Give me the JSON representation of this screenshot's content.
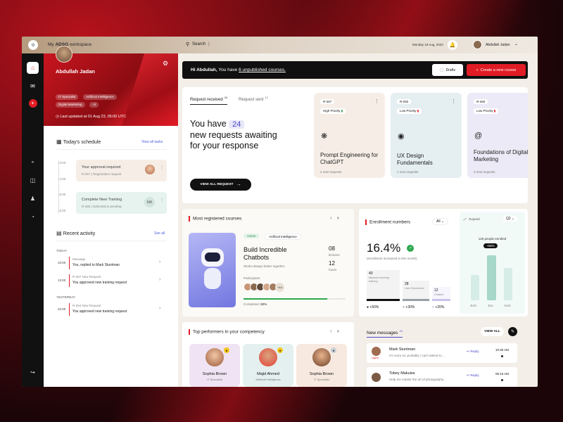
{
  "topbar": {
    "workspace_prefix": "My ",
    "workspace_name": "ADSG",
    "workspace_suffix": " workspace",
    "search_label": "Search",
    "date": "Monday 19 Aug, 2023",
    "user_name": "Abdullah Jadan"
  },
  "profile": {
    "name": "Abdullah Jadan",
    "tags": [
      "IT Specialist",
      "Artificial Intelligence",
      "Digital Marketing",
      "+3"
    ],
    "last_updated": "Last updated at 01 Aug 23, 05:00 UTC"
  },
  "schedule": {
    "title": "Today's schedule",
    "view_all": "View all tasks",
    "times": [
      "13:00",
      "14:00",
      "15:00",
      "16:00"
    ],
    "items": [
      {
        "title": "Your approval required",
        "code": "R-267",
        "sub": "Registration request",
        "avatar": ""
      },
      {
        "title": "Complete New Training",
        "code": "R-265",
        "sub": "Submission pending",
        "avatar": "MA"
      }
    ]
  },
  "activity": {
    "title": "Recent activity",
    "see_all": "See all",
    "groups": [
      {
        "label": "TODAY",
        "items": [
          {
            "time": "10:00",
            "type": "Message",
            "text": "You, replied to Mark Stuntman"
          },
          {
            "time": "13:00",
            "type": "R-267 New Request",
            "text": "You approved new training request"
          }
        ]
      },
      {
        "label": "YESTERDAY",
        "items": [
          {
            "time": "04:00",
            "type": "R-254 New Request",
            "text": "You approved new training request"
          }
        ]
      }
    ]
  },
  "hero": {
    "greeting": "Hi Abdullah,",
    "text_before": " You have ",
    "link": "6 unpublished courses.",
    "drafts": "Drafts",
    "create": "Create a new course"
  },
  "requests": {
    "tab_received": "Request received",
    "tab_received_count": "24",
    "tab_sent": "Request sent",
    "tab_sent_count": "12",
    "headline_1": "You have",
    "count": "24",
    "headline_2": "new requests awaiting",
    "headline_3": "for your response",
    "view_all": "VIEW ALL REQUEST",
    "cards": [
      {
        "code": "R-267",
        "priority": "High Priority",
        "title": "Prompt Engineering for ChatGPT",
        "count": "2 new requests",
        "bg": "#f6eee6"
      },
      {
        "code": "R-282",
        "priority": "Low Priority",
        "title": "UX Design Fundamentals",
        "count": "1 new requests",
        "bg": "#e5eef1"
      },
      {
        "code": "R-260",
        "priority": "Low Priority",
        "title": "Foundations of Digital Marketing",
        "count": "3 new requests",
        "bg": "#eceaf6"
      }
    ]
  },
  "courses": {
    "title": "Most registered courses",
    "badge_active": "Active",
    "badge_category": "Artificial Intelligence",
    "course_title": "Build Incredible Chatbots",
    "course_sub": "Works always better together.",
    "lectures_num": "08",
    "lectures_label": "lectures",
    "hours_num": "12",
    "hours_label": "hours",
    "participants_label": "Participants",
    "participants_more": "+14",
    "completed_label": "Completed",
    "completed_pct": "82%",
    "completed_value": 0.82
  },
  "enrollment": {
    "title": "Enrollment numbers",
    "filter": "All",
    "percent": "16.4%",
    "sub": "(enrollment increased in this month)",
    "bars": [
      {
        "num": "40",
        "label": "Machine learning training",
        "change": "+50%",
        "color": "#111"
      },
      {
        "num": "28",
        "label": "User Experience",
        "change": "+30%",
        "color": "#9aa0a6"
      },
      {
        "num": "12",
        "label": "Chatbot",
        "change": "+20%",
        "color": "#c9c2ea"
      }
    ],
    "expand": "Expand",
    "quarter": "Q2",
    "people": "126 people enrolled",
    "peak": "+56%",
    "months": [
      "JUN",
      "JUL",
      "AUG"
    ]
  },
  "performers": {
    "title": "Top performers in your competency",
    "people": [
      {
        "name": "Sophia Brown",
        "role": "IT Specialist",
        "bg": "#f0e3f3"
      },
      {
        "name": "Majid Ahmed",
        "role": "Artificial Intelligence",
        "bg": "#e3f0ef"
      },
      {
        "name": "Sophia Brown",
        "role": "IT Specialist",
        "bg": "#f7e9df"
      }
    ]
  },
  "messages": {
    "title": "New messages",
    "count": "24",
    "view_all": "VIEW ALL",
    "items": [
      {
        "name": "Mark Stuntman",
        "text": "I'm sorry sir, probably I can't attend to...",
        "tag": "urgent",
        "reply": "Reply",
        "time": "10:30 AM"
      },
      {
        "name": "Tobey Makuise",
        "text": "Help me master the art of photography...",
        "tag": "",
        "reply": "Reply",
        "time": "06:15 AM"
      }
    ]
  }
}
